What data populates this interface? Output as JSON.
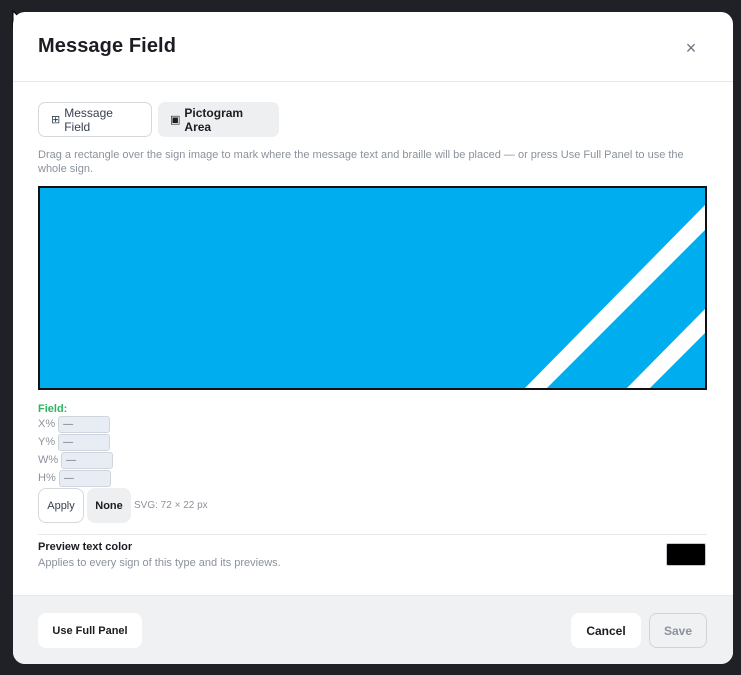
{
  "dialog": {
    "title": "Message Field",
    "close_glyph": "×"
  },
  "tabs": [
    {
      "icon": "grid-icon",
      "glyph": "⊞",
      "label": "Message Field"
    },
    {
      "icon": "square-icon",
      "glyph": "▣",
      "label": "Pictogram Area"
    }
  ],
  "description": "Drag a rectangle over the sign image to mark where the message text and braille will be placed — or press Use Full Panel to use the whole sign.",
  "sign": {
    "background_color": "#00aeef",
    "stripe_color": "#ffffff"
  },
  "field": {
    "label": "Field:",
    "x": {
      "label": "X%",
      "value": "—"
    },
    "y": {
      "label": "Y%",
      "value": "—"
    },
    "w": {
      "label": "W%",
      "value": "—"
    },
    "h": {
      "label": "H%",
      "value": "—"
    },
    "apply_label": "Apply",
    "none_label": "None",
    "svg_size": "SVG: 72 × 22 px"
  },
  "preview_color": {
    "title": "Preview text color",
    "subtitle": "Applies to every sign of this type and its previews.",
    "value": "#000000"
  },
  "footer": {
    "full_panel_label": "Use Full Panel",
    "cancel_label": "Cancel",
    "save_label": "Save"
  }
}
